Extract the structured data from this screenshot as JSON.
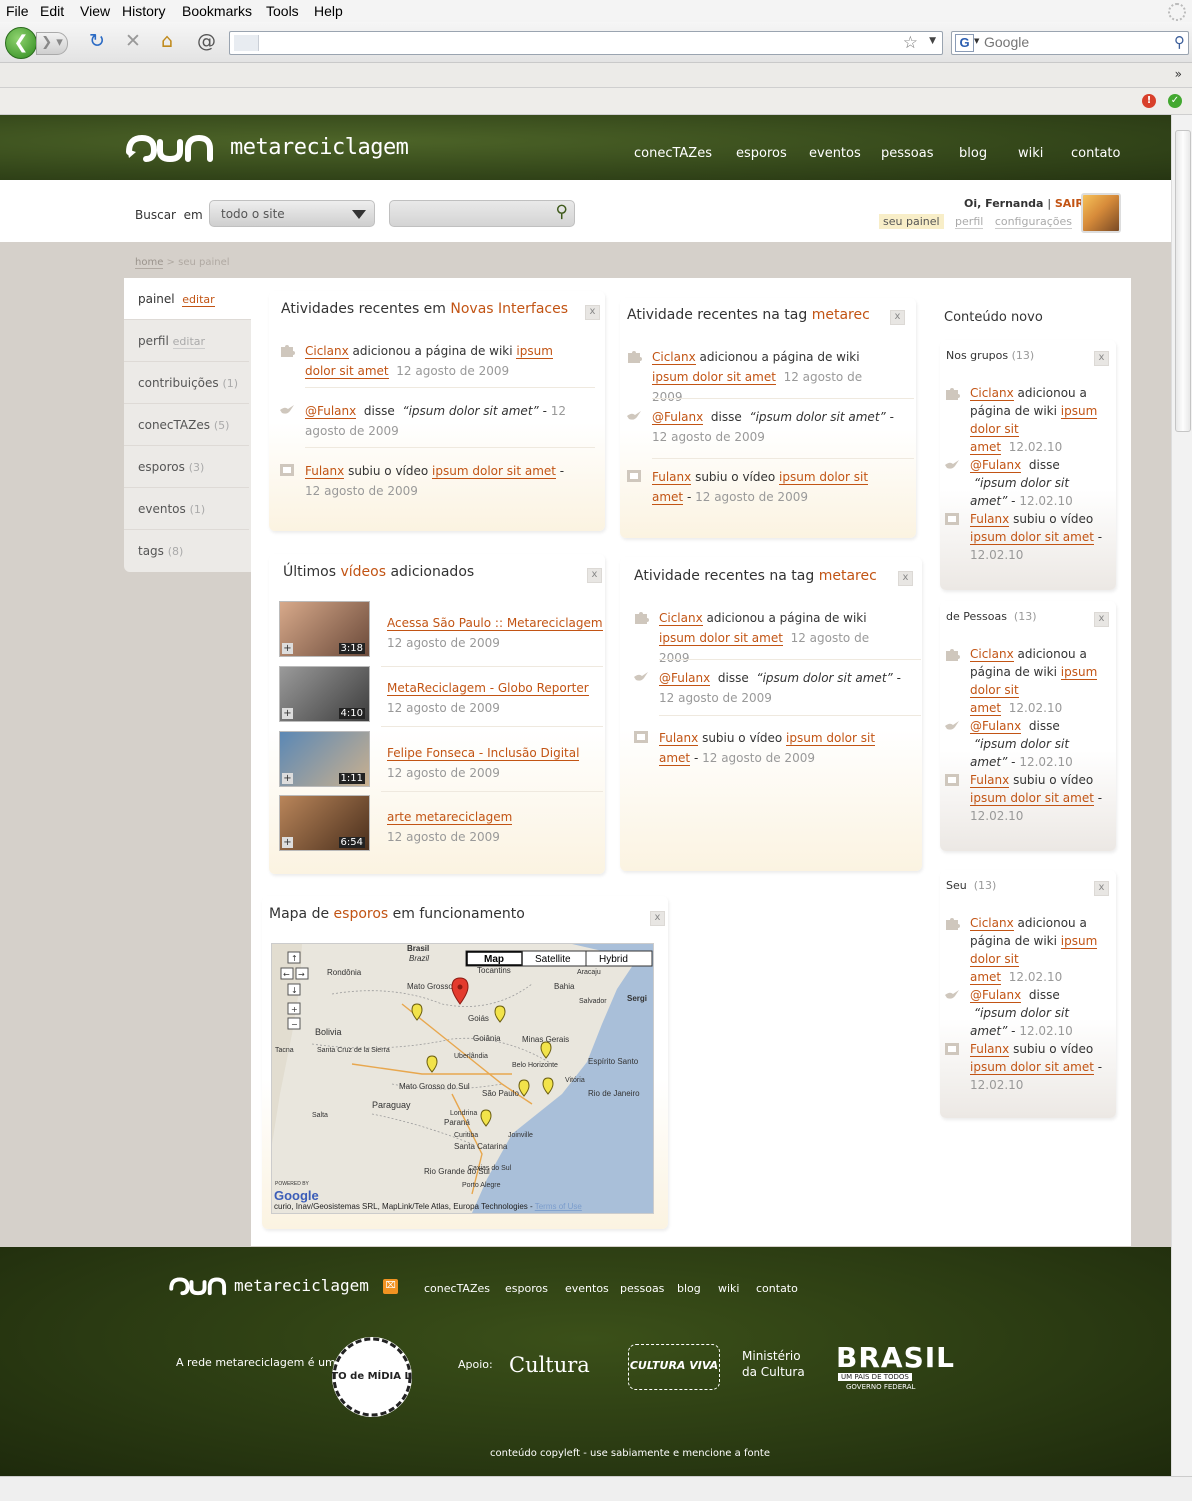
{
  "browser": {
    "menu": [
      "File",
      "Edit",
      "View",
      "History",
      "Bookmarks",
      "Tools",
      "Help"
    ],
    "search_placeholder": "Google",
    "search_engine_glyph": "G",
    "url": ""
  },
  "site": {
    "name": "metareciclagem",
    "nav": [
      "conecTAZes",
      "esporos",
      "eventos",
      "pessoas",
      "blog",
      "wiki",
      "contato"
    ],
    "search": {
      "label": "Buscar",
      "em": "em",
      "scope": "todo o site",
      "placeholder": ""
    },
    "user": {
      "greeting": "Oi, Fernanda",
      "sep": "|",
      "logout": "SAIR",
      "links": [
        "seu painel",
        "perfil",
        "configurações"
      ]
    },
    "breadcrumb": {
      "home": "home",
      "sep": ">",
      "current": "seu painel"
    }
  },
  "leftnav": [
    {
      "label": "painel",
      "extra": "editar",
      "extra_type": "edit"
    },
    {
      "label": "perfil",
      "extra": "editar",
      "extra_type": "edit-gray"
    },
    {
      "label": "contribuições",
      "extra": "(1)",
      "extra_type": "count"
    },
    {
      "label": "conecTAZes",
      "extra": "(5)",
      "extra_type": "count"
    },
    {
      "label": "esporos",
      "extra": "(3)",
      "extra_type": "count"
    },
    {
      "label": "eventos",
      "extra": "(1)",
      "extra_type": "count"
    },
    {
      "label": "tags",
      "extra": "(8)",
      "extra_type": "count"
    }
  ],
  "panels": {
    "atividades": {
      "title_prefix": "Atividades recentes em ",
      "title_highlight": "Novas Interfaces",
      "close": "x"
    },
    "tag1": {
      "title_prefix": "Atividade  recentes na tag ",
      "title_highlight": "metarec",
      "close": "x"
    },
    "tag2": {
      "title_prefix": "Atividade  recentes na tag ",
      "title_highlight": "metarec",
      "close": "x"
    },
    "videos": {
      "title_prefix": "Últimos ",
      "title_highlight": "vídeos",
      "title_suffix": " adicionados",
      "close": "x"
    },
    "mapa": {
      "title_prefix": "Mapa de ",
      "title_highlight": "esporos",
      "title_suffix": " em funcionamento",
      "close": "x"
    },
    "conteudo": {
      "title": "Conteúdo novo"
    }
  },
  "activity": {
    "user1": "Ciclanx",
    "wiki_text": " adicionou a página de wiki ",
    "link": "ipsum dolor sit amet",
    "user2": "@Fulanx",
    "said": " disse ",
    "quote": "“ipsum dolor sit amet”",
    "dash": " - ",
    "user3": "Fulanx",
    "video_text": " subiu o vídeo ",
    "date_long": "12 agosto de 2009",
    "date_short": "12.02.10"
  },
  "conteudo_groups": [
    {
      "label": "Nos grupos",
      "count": "(13)"
    },
    {
      "label": "de Pessoas",
      "count": "(13)"
    },
    {
      "label": "Seu",
      "count": "(13)"
    }
  ],
  "videos": [
    {
      "title": "Acessa São Paulo :: Metareciclagem",
      "date": "12 agosto de 2009",
      "duration": "3:18",
      "color1": "#6b4a3a",
      "color2": "#d7a98a"
    },
    {
      "title": "MetaReciclagem - Globo Reporter",
      "date": "12 agosto de 2009",
      "duration": "4:10",
      "color1": "#3d3d3d",
      "color2": "#9a9a9a"
    },
    {
      "title": "Felipe Fonseca - Inclusão Digital",
      "date": "12 agosto de 2009",
      "duration": "1:11",
      "color1": "#5b88b5",
      "color2": "#c9b08f"
    },
    {
      "title": "arte metareciclagem",
      "date": "12 agosto de 2009",
      "duration": "6:54",
      "color1": "#4a2f1c",
      "color2": "#b9855a"
    }
  ],
  "map": {
    "buttons": [
      "Map",
      "Satellite",
      "Hybrid"
    ],
    "labels": [
      "Brasil",
      "Brazil",
      "Tocantins",
      "Rondônia",
      "Mato Grosso",
      "Bahia",
      "Goiás",
      "Goiânia",
      "Bolivia",
      "Santa Cruz de la Sierra",
      "Minas Gerais",
      "Espírito Santo",
      "Mato Grosso do Sul",
      "São Paulo",
      "Rio de Janeiro",
      "Paraguay",
      "Paraná",
      "Santa Catarina",
      "Rio Grande do Sul",
      "Salta",
      "Aracaju",
      "Salvador",
      "Vitória",
      "Uberlândia",
      "Belo Horizonte",
      "Londrina",
      "Curitiba",
      "Joinville",
      "Caxias do Sul",
      "Porto Alegre",
      "Tacna",
      "Sergi"
    ],
    "attribution": "curio, Inav/Geosistemas SRL, MapLink/Tele Atlas, Europa Technologies - ",
    "terms": "Terms of Use",
    "powered": "POWERED BY",
    "google": "Google",
    "water": "#a9bfd9",
    "land": "#e9e6dd"
  },
  "footer": {
    "name": "metareciclagem",
    "nav": [
      "conecTAZes",
      "esporos",
      "eventos",
      "pessoas",
      "blog",
      "wiki",
      "contato"
    ],
    "rede": "A rede metareciclagem é um",
    "badge": "PONTO de MÍDIA LIVRE",
    "apoio": "Apoio:",
    "sponsors": [
      "Cultura",
      "CULTURA VIVA",
      "Ministério",
      "da Cultura",
      "BRASIL",
      "UM PAÍS DE TODOS",
      "GOVERNO FEDERAL"
    ],
    "copyleft": "conteúdo copyleft - use sabiamente e mencione a fonte"
  },
  "colors": {
    "accent": "#c25414",
    "header_green": "#34471a",
    "bg": "#d5d0ca"
  }
}
